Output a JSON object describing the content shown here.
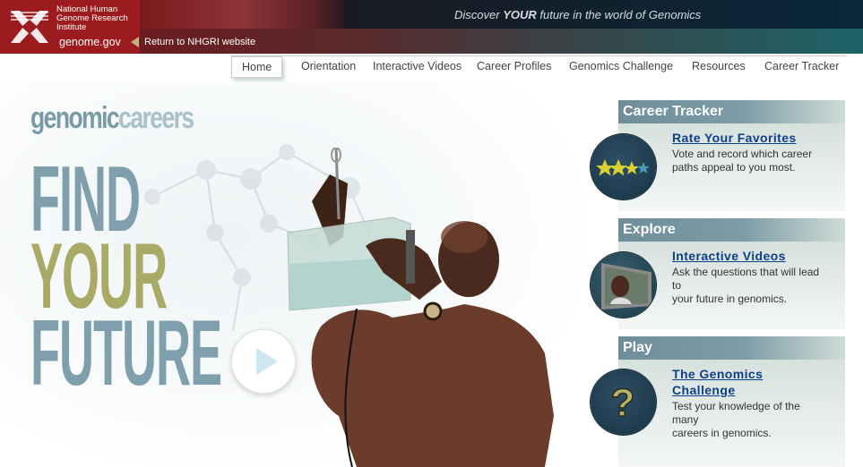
{
  "header": {
    "org_name": "National Human Genome Research Institute",
    "org_lines": [
      "National Human",
      "Genome Research",
      "Institute"
    ],
    "site": "genome.gov",
    "return_link": "Return to NHGRI website",
    "tagline_pre": "Discover ",
    "tagline_bold": "YOUR",
    "tagline_post": " future in the world of Genomics"
  },
  "nav": {
    "items": [
      {
        "label": "Home",
        "active": true
      },
      {
        "label": "Orientation"
      },
      {
        "label": "Interactive Videos"
      },
      {
        "label": "Career Profiles"
      },
      {
        "label": "Genomics Challenge"
      },
      {
        "label": "Resources"
      },
      {
        "label": "Career Tracker"
      }
    ]
  },
  "hero": {
    "brand_a": "genomic",
    "brand_b": "careers",
    "line1": "FIND",
    "line2": "YOUR",
    "line3": "FUTURE",
    "play_icon": "play-icon"
  },
  "sidebar": {
    "panels": [
      {
        "heading": "Career Tracker",
        "title": "Rate Your Favorites",
        "title_lines": [
          "Rate Your Favorites"
        ],
        "description": "Vote and record which career paths appeal to you most.",
        "desc_lines": [
          "Vote and record which career",
          "paths appeal to you most."
        ],
        "icon": "stars-icon",
        "rating": "3 of 4 stars"
      },
      {
        "heading": "Explore",
        "title": "Interactive Videos",
        "title_lines": [
          "Interactive Videos"
        ],
        "description": "Ask the questions that will lead to your future in genomics.",
        "desc_lines": [
          "Ask the questions that will lead to",
          "your future in genomics."
        ],
        "icon": "video-screen-icon"
      },
      {
        "heading": "Play",
        "title": "The Genomics Challenge",
        "title_lines": [
          "The Genomics",
          "Challenge"
        ],
        "description": "Test your knowledge of the many careers in genomics.",
        "desc_lines": [
          "Test your knowledge of the many",
          "careers in genomics."
        ],
        "icon": "question-mark-icon"
      }
    ]
  },
  "colors": {
    "header_red": "#9c1b1e",
    "link_blue": "#0e3f8a",
    "hero_blue": "#7f9fac",
    "hero_olive": "#a8aa66",
    "panel_head": "#7c9ca6"
  }
}
